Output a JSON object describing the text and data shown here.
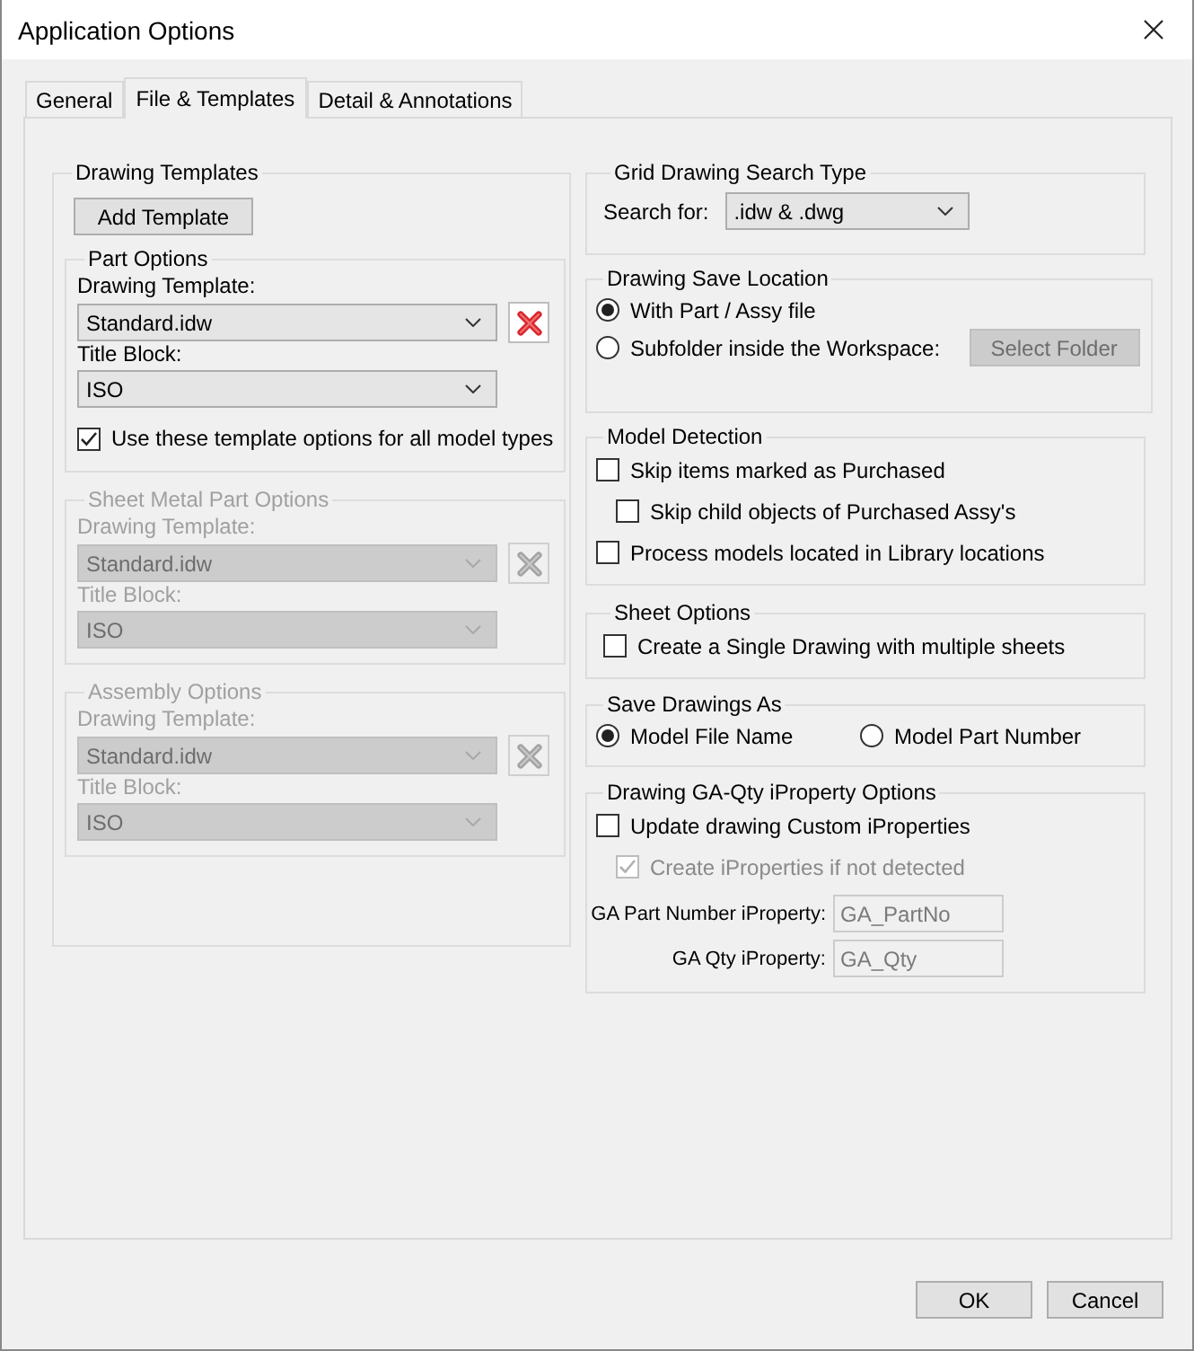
{
  "window": {
    "title": "Application Options"
  },
  "tabs": [
    {
      "label": "General",
      "selected": false
    },
    {
      "label": "File & Templates",
      "selected": true
    },
    {
      "label": "Detail & Annotations",
      "selected": false
    }
  ],
  "drawing_templates": {
    "title": "Drawing Templates",
    "add_button": "Add Template",
    "sections": [
      {
        "title": "Part Options",
        "disabled": false,
        "template_label": "Drawing Template:",
        "template_value": "Standard.idw",
        "title_block_label": "Title Block:",
        "title_block_value": "ISO",
        "checkbox": {
          "label": "Use these template options for all model types",
          "checked": true
        }
      },
      {
        "title": "Sheet Metal Part Options",
        "disabled": true,
        "template_label": "Drawing Template:",
        "template_value": "Standard.idw",
        "title_block_label": "Title Block:",
        "title_block_value": "ISO"
      },
      {
        "title": "Assembly Options",
        "disabled": true,
        "template_label": "Drawing Template:",
        "template_value": "Standard.idw",
        "title_block_label": "Title Block:",
        "title_block_value": "ISO"
      }
    ]
  },
  "grid_search": {
    "title": "Grid Drawing Search Type",
    "label": "Search for:",
    "value": ".idw & .dwg"
  },
  "save_location": {
    "title": "Drawing Save Location",
    "options": [
      {
        "label": "With Part / Assy file",
        "selected": true
      },
      {
        "label": "Subfolder inside the Workspace:",
        "selected": false
      }
    ],
    "button": {
      "label": "Select Folder",
      "disabled": true
    }
  },
  "model_detection": {
    "title": "Model Detection",
    "items": [
      {
        "label": "Skip items marked as Purchased",
        "checked": false,
        "disabled": false,
        "children": [
          {
            "label": "Skip child objects of Purchased Assy's",
            "checked": false,
            "disabled": false
          }
        ]
      },
      {
        "label": "Process models located in Library locations",
        "checked": false,
        "disabled": false
      }
    ]
  },
  "sheet_options": {
    "title": "Sheet Options",
    "items": [
      {
        "label": "Create a Single Drawing with multiple sheets",
        "checked": false,
        "disabled": false
      }
    ]
  },
  "save_as": {
    "title": "Save Drawings As",
    "options": [
      {
        "label": "Model File Name",
        "selected": true
      },
      {
        "label": "Model Part Number",
        "selected": false
      }
    ]
  },
  "ga_qty": {
    "title": "Drawing GA-Qty iProperty Options",
    "items": [
      {
        "label": "Update drawing Custom iProperties",
        "checked": false,
        "disabled": false,
        "children": [
          {
            "label": "Create iProperties if not detected",
            "checked": true,
            "disabled": true
          }
        ]
      }
    ],
    "fields": [
      {
        "label": "GA Part Number iProperty:",
        "value": "GA_PartNo",
        "disabled": true
      },
      {
        "label": "GA Qty iProperty:",
        "value": "GA_Qty",
        "disabled": true
      }
    ]
  },
  "buttons": [
    {
      "label": "OK"
    },
    {
      "label": "Cancel"
    }
  ]
}
